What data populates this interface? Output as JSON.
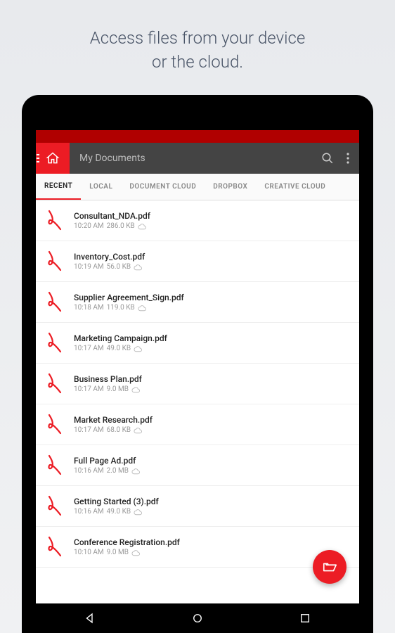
{
  "promo": {
    "line1": "Access files from your device",
    "line2": "or the cloud."
  },
  "header": {
    "title": "My Documents"
  },
  "tabs": [
    {
      "label": "RECENT",
      "active": true
    },
    {
      "label": "LOCAL",
      "active": false
    },
    {
      "label": "DOCUMENT CLOUD",
      "active": false
    },
    {
      "label": "DROPBOX",
      "active": false
    },
    {
      "label": "CREATIVE CLOUD",
      "active": false
    }
  ],
  "files": [
    {
      "name": "Consultant_NDA.pdf",
      "time": "10:20 AM",
      "size": "286.0 KB"
    },
    {
      "name": "Inventory_Cost.pdf",
      "time": "10:19 AM",
      "size": "56.0 KB"
    },
    {
      "name": "Supplier Agreement_Sign.pdf",
      "time": "10:18 AM",
      "size": "119.0 KB"
    },
    {
      "name": "Marketing Campaign.pdf",
      "time": "10:17 AM",
      "size": "49.0 KB"
    },
    {
      "name": "Business Plan.pdf",
      "time": "10:17 AM",
      "size": "9.0 MB"
    },
    {
      "name": "Market Research.pdf",
      "time": "10:17 AM",
      "size": "68.0 KB"
    },
    {
      "name": "Full Page Ad.pdf",
      "time": "10:16 AM",
      "size": "2.0 MB"
    },
    {
      "name": "Getting Started (3).pdf",
      "time": "10:16 AM",
      "size": "49.0 KB"
    },
    {
      "name": "Conference Registration.pdf",
      "time": "10:10 AM",
      "size": "9.0 MB"
    }
  ],
  "colors": {
    "accent": "#ec1c24",
    "header_bg": "#444"
  }
}
